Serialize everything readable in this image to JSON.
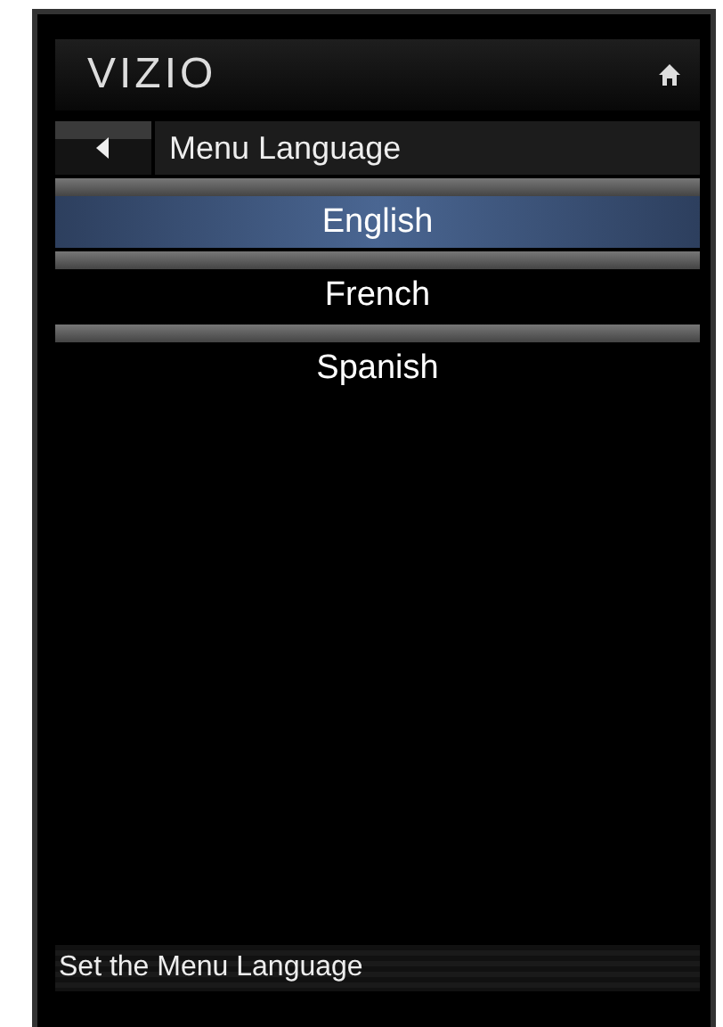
{
  "header": {
    "logo": "VIZIO"
  },
  "title_bar": {
    "title": "Menu Language"
  },
  "menu_items": [
    {
      "label": "English",
      "selected": true
    },
    {
      "label": "French",
      "selected": false
    },
    {
      "label": "Spanish",
      "selected": false
    }
  ],
  "hint": "Set the Menu Language"
}
